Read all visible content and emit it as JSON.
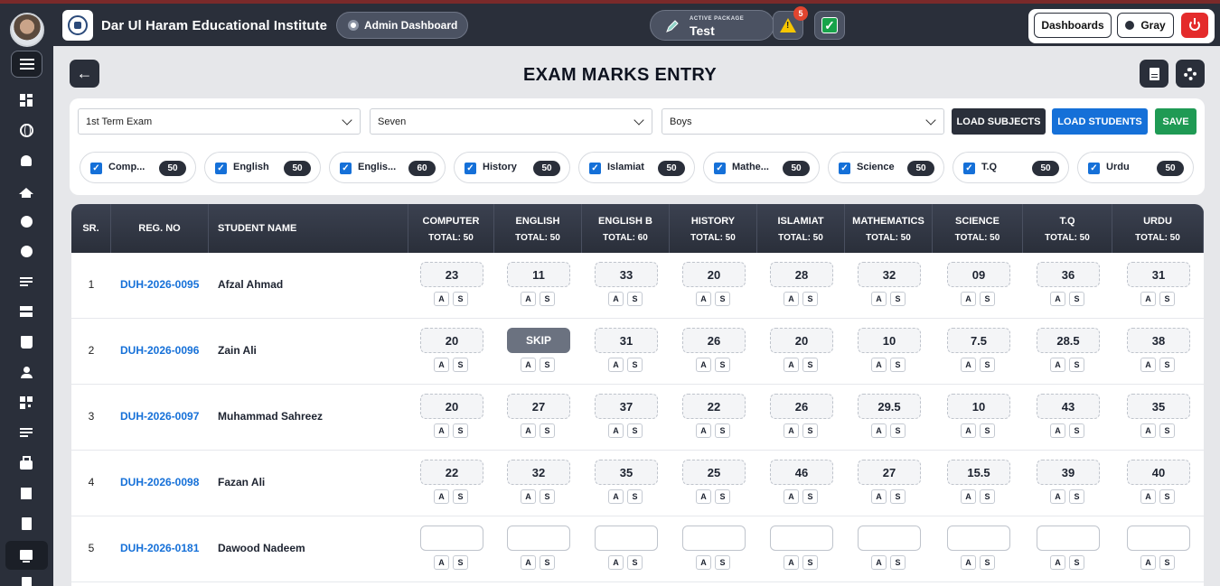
{
  "header": {
    "school_name": "Dar Ul Haram Educational Institute",
    "dashboard_pill": "Admin Dashboard",
    "package_label": "ACTIVE PACKAGE",
    "package_name": "Test",
    "alert_count": "5",
    "dashboards_label": "Dashboards",
    "theme_label": "Gray"
  },
  "page": {
    "title": "EXAM MARKS ENTRY"
  },
  "filters": {
    "exam": "1st Term Exam",
    "class": "Seven",
    "section": "Boys",
    "load_subjects": "LOAD SUBJECTS",
    "load_students": "LOAD STUDENTS",
    "save": "SAVE"
  },
  "subject_chips": [
    {
      "label": "Comp...",
      "total": "50"
    },
    {
      "label": "English",
      "total": "50"
    },
    {
      "label": "Englis...",
      "total": "60"
    },
    {
      "label": "History",
      "total": "50"
    },
    {
      "label": "Islamiat",
      "total": "50"
    },
    {
      "label": "Mathe...",
      "total": "50"
    },
    {
      "label": "Science",
      "total": "50"
    },
    {
      "label": "T.Q",
      "total": "50"
    },
    {
      "label": "Urdu",
      "total": "50"
    }
  ],
  "table": {
    "col_sr": "SR.",
    "col_reg": "REG. NO",
    "col_name": "STUDENT NAME",
    "subjects": [
      {
        "name": "COMPUTER",
        "total": "TOTAL: 50"
      },
      {
        "name": "ENGLISH",
        "total": "TOTAL: 50"
      },
      {
        "name": "ENGLISH B",
        "total": "TOTAL: 60"
      },
      {
        "name": "HISTORY",
        "total": "TOTAL: 50"
      },
      {
        "name": "ISLAMIAT",
        "total": "TOTAL: 50"
      },
      {
        "name": "MATHEMATICS",
        "total": "TOTAL: 50"
      },
      {
        "name": "SCIENCE",
        "total": "TOTAL: 50"
      },
      {
        "name": "T.Q",
        "total": "TOTAL: 50"
      },
      {
        "name": "URDU",
        "total": "TOTAL: 50"
      }
    ],
    "absent_label": "A",
    "skip_label": "S",
    "rows": [
      {
        "sr": "1",
        "reg": "DUH-2026-0095",
        "name": "Afzal Ahmad",
        "marks": [
          "23",
          "11",
          "33",
          "20",
          "28",
          "32",
          "09",
          "36",
          "31"
        ]
      },
      {
        "sr": "2",
        "reg": "DUH-2026-0096",
        "name": "Zain Ali",
        "marks": [
          "20",
          "SKIP",
          "31",
          "26",
          "20",
          "10",
          "7.5",
          "28.5",
          "38"
        ]
      },
      {
        "sr": "3",
        "reg": "DUH-2026-0097",
        "name": "Muhammad Sahreez",
        "marks": [
          "20",
          "27",
          "37",
          "22",
          "26",
          "29.5",
          "10",
          "43",
          "35"
        ]
      },
      {
        "sr": "4",
        "reg": "DUH-2026-0098",
        "name": "Fazan Ali",
        "marks": [
          "22",
          "32",
          "35",
          "25",
          "46",
          "27",
          "15.5",
          "39",
          "40"
        ]
      },
      {
        "sr": "5",
        "reg": "DUH-2026-0181",
        "name": "Dawood Nadeem",
        "marks": [
          "",
          "",
          "",
          "",
          "",
          "",
          "",
          "",
          ""
        ]
      }
    ]
  },
  "icons": {
    "sidebar": [
      "dashboard-icon",
      "globe-icon",
      "bell-icon",
      "graduation-cap-icon",
      "circle-icon",
      "circle-icon",
      "list-icon",
      "layers-icon",
      "book-icon",
      "user-icon",
      "qr-icon",
      "list-icon",
      "briefcase-icon",
      "square-icon",
      "document-icon",
      "monitor-icon"
    ]
  }
}
